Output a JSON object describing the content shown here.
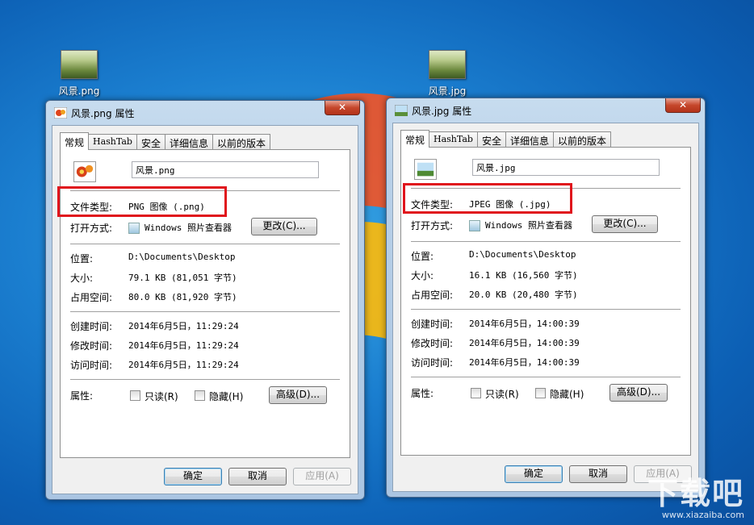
{
  "desktop": {
    "icon_left_label": "风景.png",
    "icon_right_label": "风景.jpg",
    "watermark_big": "下载吧",
    "watermark_small": "www.xiazaiba.com"
  },
  "common": {
    "close_glyph": "✕",
    "tabs": [
      "常规",
      "HashTab",
      "安全",
      "详细信息",
      "以前的版本"
    ],
    "labels": {
      "file_type": "文件类型:",
      "open_with": "打开方式:",
      "location": "位置:",
      "size": "大小:",
      "size_on_disk": "占用空间:",
      "created": "创建时间:",
      "modified": "修改时间:",
      "accessed": "访问时间:",
      "attributes": "属性:"
    },
    "change_button": "更改(C)...",
    "readonly_label": "只读(R)",
    "hidden_label": "隐藏(H)",
    "advanced_button": "高级(D)...",
    "ok_button": "确定",
    "cancel_button": "取消",
    "apply_button": "应用(A)"
  },
  "png_dialog": {
    "title": "风景.png 属性",
    "filename": "风景.png",
    "file_type": "PNG 图像 (.png)",
    "open_with": "Windows 照片查看器",
    "location": "D:\\Documents\\Desktop",
    "size": "79.1 KB (81,051 字节)",
    "size_on_disk": "80.0 KB (81,920 字节)",
    "created": "2014年6月5日，11:29:24",
    "modified": "2014年6月5日，11:29:24",
    "accessed": "2014年6月5日，11:29:24"
  },
  "jpg_dialog": {
    "title": "风景.jpg 属性",
    "filename": "风景.jpg",
    "file_type": "JPEG 图像 (.jpg)",
    "open_with": "Windows 照片查看器",
    "location": "D:\\Documents\\Desktop",
    "size": "16.1 KB (16,560 字节)",
    "size_on_disk": "20.0 KB (20,480 字节)",
    "created": "2014年6月5日，14:00:39",
    "modified": "2014年6月5日，14:00:39",
    "accessed": "2014年6月5日，14:00:39"
  },
  "colors": {
    "highlight": "#e0141c",
    "desktop": "#1b7fd0"
  }
}
